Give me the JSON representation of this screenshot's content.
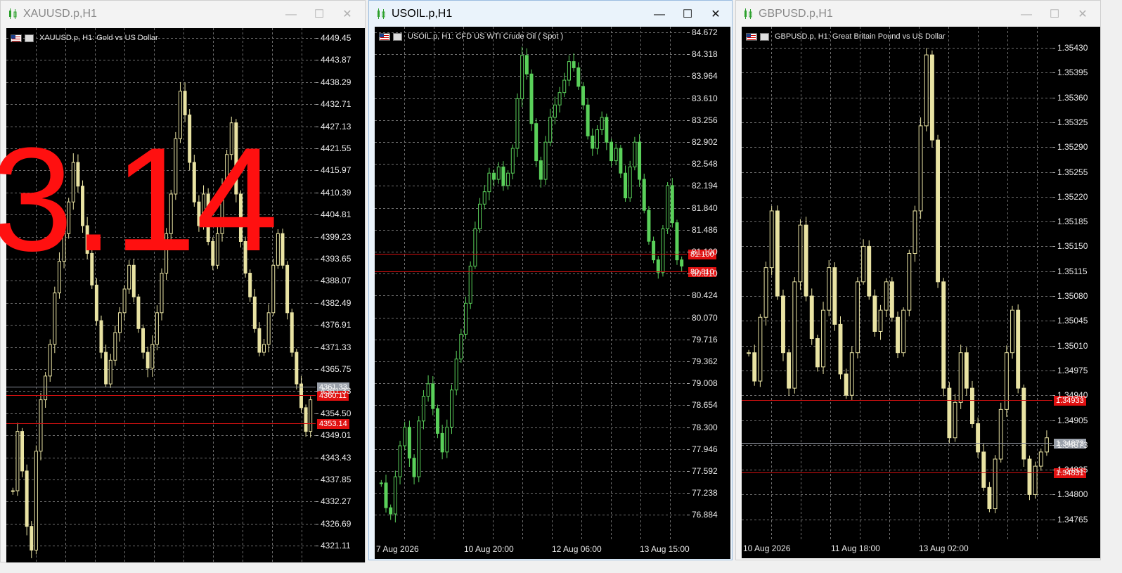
{
  "windows": [
    {
      "id": "xau",
      "title": "XAUUSD.p,H1",
      "symbol_line": "XAUUSD.p, H1:  Gold vs US Dollar",
      "prices": [
        "4449.45",
        "4443.87",
        "4438.29",
        "4432.71",
        "4427.13",
        "4421.55",
        "4415.97",
        "4410.39",
        "4404.81",
        "4399.23",
        "4393.65",
        "4388.07",
        "4382.49",
        "4376.91",
        "4371.33",
        "4365.75",
        "4361.33",
        "4354.50",
        "4349.01",
        "4343.43",
        "4337.85",
        "4332.27",
        "4326.69",
        "4321.11"
      ],
      "tags": [
        {
          "text": "4361.33",
          "style": "grey",
          "price": 4361.33
        },
        {
          "text": "4360.11",
          "style": "red",
          "price": 4359.2
        },
        {
          "text": "4353.14",
          "style": "red",
          "price": 4352.1
        }
      ],
      "time_labels": [],
      "overlay_text": "3.14",
      "candle_color": "#e9e3a3",
      "series": [
        4335,
        4350,
        4340,
        4326,
        4320,
        4345,
        4358,
        4364,
        4372,
        4385,
        4393,
        4400,
        4408,
        4418,
        4412,
        4402,
        4395,
        4387,
        4378,
        4370,
        4362,
        4368,
        4375,
        4380,
        4386,
        4392,
        4384,
        4376,
        4370,
        4366,
        4372,
        4380,
        4390,
        4400,
        4410,
        4424,
        4436,
        4430,
        4418,
        4408,
        4402,
        4410,
        4398,
        4392,
        4400,
        4412,
        4420,
        4428,
        4410,
        4398,
        4390,
        4384,
        4376,
        4370,
        4372,
        4380,
        4392,
        4400,
        4392,
        4380,
        4370,
        4362,
        4356,
        4350,
        4358
      ]
    },
    {
      "id": "oil",
      "title": "USOIL.p,H1",
      "symbol_line": "USOIL.p, H1:  CFD US WTI Crude Oil ( Spot )",
      "prices": [
        "84.672",
        "84.318",
        "83.964",
        "83.610",
        "83.256",
        "82.902",
        "82.548",
        "82.194",
        "81.840",
        "81.486",
        "81.100",
        "80.810",
        "80.424",
        "80.070",
        "79.716",
        "79.362",
        "79.008",
        "78.654",
        "78.300",
        "77.946",
        "77.592",
        "77.238",
        "76.884"
      ],
      "tags": [
        {
          "text": "81.100",
          "style": "red",
          "price": 81.1
        },
        {
          "text": "80.810",
          "style": "red",
          "price": 80.81
        }
      ],
      "time_labels": [
        "7 Aug 2026",
        "10 Aug 20:00",
        "12 Aug 06:00",
        "13 Aug 15:00"
      ],
      "overlay_text": "",
      "candle_color": "#5ad05a",
      "series": [
        77.4,
        77.0,
        76.9,
        77.5,
        78.0,
        78.3,
        77.8,
        77.5,
        78.4,
        78.8,
        79.0,
        78.6,
        78.2,
        77.9,
        78.3,
        78.9,
        79.4,
        79.8,
        80.3,
        80.9,
        81.5,
        81.9,
        82.1,
        82.4,
        82.3,
        82.5,
        82.2,
        82.4,
        82.8,
        83.6,
        84.3,
        84.0,
        83.2,
        82.6,
        82.3,
        82.9,
        83.3,
        83.5,
        83.7,
        83.9,
        84.2,
        84.1,
        83.8,
        83.5,
        83.0,
        82.8,
        83.1,
        83.3,
        82.9,
        82.6,
        82.8,
        82.4,
        82.0,
        82.5,
        82.9,
        82.3,
        81.8,
        81.3,
        81.0,
        80.8,
        81.5,
        82.2,
        81.6,
        81.0,
        80.9
      ]
    },
    {
      "id": "gbp",
      "title": "GBPUSD.p,H1",
      "symbol_line": "GBPUSD.p, H1:  Great Britain Pound vs US Dollar",
      "prices": [
        "1.35430",
        "1.35395",
        "1.35360",
        "1.35325",
        "1.35290",
        "1.35255",
        "1.35220",
        "1.35185",
        "1.35150",
        "1.35115",
        "1.35080",
        "1.35045",
        "1.35010",
        "1.34975",
        "1.34940",
        "1.34905",
        "1.34873",
        "1.34835",
        "1.34800",
        "1.34765"
      ],
      "tags": [
        {
          "text": "1.34933",
          "style": "red",
          "price": 1.34933
        },
        {
          "text": "1.34873",
          "style": "grey",
          "price": 1.34873
        },
        {
          "text": "1.34831",
          "style": "red",
          "price": 1.34831
        }
      ],
      "time_labels": [
        "10 Aug 2026",
        "11 Aug 18:00",
        "13 Aug 02:00"
      ],
      "overlay_text": "",
      "candle_color": "#e9e3a3",
      "series": [
        1.35,
        1.3496,
        1.3505,
        1.3512,
        1.352,
        1.3508,
        1.35,
        1.3495,
        1.351,
        1.3518,
        1.3508,
        1.3502,
        1.3498,
        1.3506,
        1.3512,
        1.3504,
        1.3497,
        1.3494,
        1.35,
        1.351,
        1.3515,
        1.3508,
        1.3503,
        1.3506,
        1.351,
        1.3505,
        1.35,
        1.3506,
        1.3514,
        1.352,
        1.3532,
        1.3542,
        1.353,
        1.351,
        1.3495,
        1.3488,
        1.3493,
        1.35,
        1.3495,
        1.349,
        1.3486,
        1.3481,
        1.3478,
        1.3485,
        1.3492,
        1.35,
        1.3506,
        1.3495,
        1.3485,
        1.348,
        1.3484,
        1.3486,
        1.3488
      ]
    }
  ],
  "buttons": {
    "minimize": "—",
    "maximize": "☐",
    "close": "✕"
  }
}
